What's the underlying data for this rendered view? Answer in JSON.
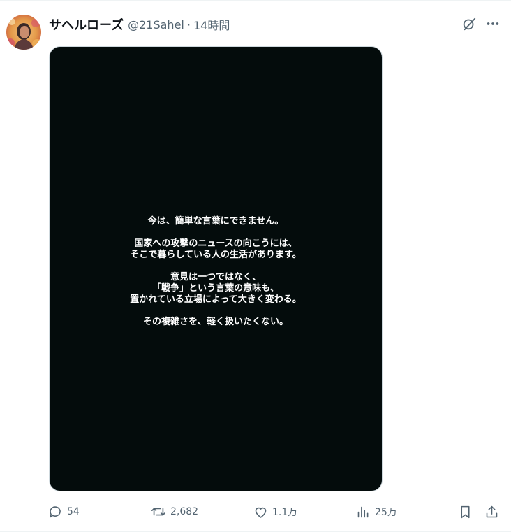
{
  "author": {
    "display_name": "サヘルローズ",
    "handle": "@21Sahel",
    "separator": "·",
    "time": "14時間"
  },
  "icons": {
    "grok": "slashed-circle-icon",
    "more": "more-dots-icon",
    "reply": "reply-icon",
    "retweet": "retweet-icon",
    "like": "heart-icon",
    "views": "bar-chart-icon",
    "bookmark": "bookmark-icon",
    "share": "share-icon"
  },
  "media": {
    "paragraphs": [
      [
        "今は、簡単な言葉にできません。"
      ],
      [
        "国家への攻撃のニュースの向こうには、",
        "そこで暮らしている人の生活があります。"
      ],
      [
        "意見は一つではなく、",
        "「戦争」という言葉の意味も、",
        "置かれている立場によって大きく変わる。"
      ],
      [
        "その複雑さを、軽く扱いたくない。"
      ]
    ]
  },
  "actions": {
    "replies": "54",
    "retweets": "2,682",
    "likes": "1.1万",
    "views": "25万"
  },
  "colors": {
    "text": "#0f1419",
    "secondary": "#536471",
    "media_bg": "#040c0c",
    "media_border": "#cfd9de"
  }
}
